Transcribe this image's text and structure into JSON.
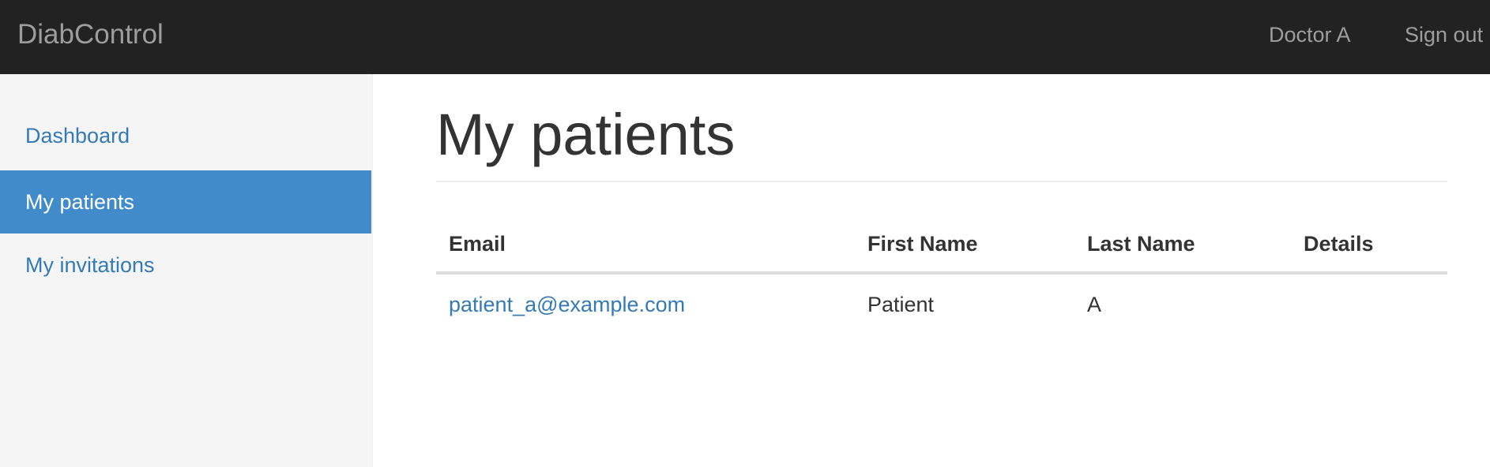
{
  "navbar": {
    "brand": "DiabControl",
    "user": "Doctor A",
    "sign_out": "Sign out"
  },
  "sidebar": {
    "items": [
      {
        "label": "Dashboard",
        "active": false
      },
      {
        "label": "My patients",
        "active": true
      },
      {
        "label": "My invitations",
        "active": false
      }
    ]
  },
  "main": {
    "title": "My patients",
    "table": {
      "columns": [
        "Email",
        "First Name",
        "Last Name",
        "Details"
      ],
      "rows": [
        {
          "email": "patient_a@example.com",
          "first_name": "Patient",
          "last_name": "A",
          "details": ""
        }
      ]
    }
  },
  "colors": {
    "navbar_bg": "#222222",
    "navbar_text": "#9d9d9d",
    "sidebar_bg": "#f5f5f5",
    "active_bg": "#428bca",
    "link": "#337ab7",
    "text": "#333333"
  }
}
